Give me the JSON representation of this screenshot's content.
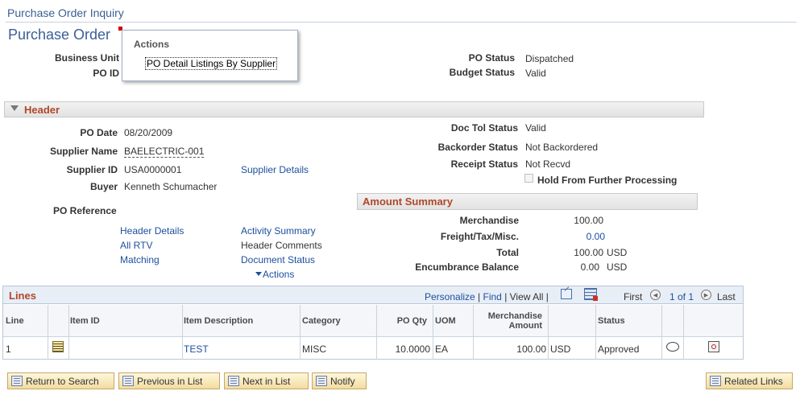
{
  "breadcrumb": "Purchase Order Inquiry",
  "page_title": "Purchase Order",
  "actions_popup": {
    "title": "Actions",
    "item": "PO Detail Listings By Supplier"
  },
  "top": {
    "business_unit_label": "Business Unit",
    "po_id_label": "PO ID",
    "po_status_label": "PO Status",
    "po_status_value": "Dispatched",
    "budget_status_label": "Budget Status",
    "budget_status_value": "Valid"
  },
  "header": {
    "section_label": "Header",
    "po_date_label": "PO Date",
    "po_date": "08/20/2009",
    "supplier_name_label": "Supplier Name",
    "supplier_name": "BAELECTRIC-001",
    "supplier_id_label": "Supplier ID",
    "supplier_id": "USA0000001",
    "supplier_details_link": "Supplier Details",
    "buyer_label": "Buyer",
    "buyer": "Kenneth Schumacher",
    "po_reference_label": "PO Reference",
    "doc_tol_label": "Doc Tol Status",
    "doc_tol": "Valid",
    "backorder_label": "Backorder Status",
    "backorder": "Not Backordered",
    "receipt_label": "Receipt Status",
    "receipt": "Not Recvd",
    "hold_label": "Hold From Further Processing",
    "links_left": [
      "Header Details",
      "All RTV",
      "Matching"
    ],
    "links_right": [
      "Activity Summary",
      "Header Comments",
      "Document Status"
    ],
    "actions_link": "Actions"
  },
  "amount_summary": {
    "label": "Amount Summary",
    "merch_label": "Merchandise",
    "merch": "100.00",
    "freight_label": "Freight/Tax/Misc.",
    "freight": "0.00",
    "total_label": "Total",
    "total": "100.00",
    "total_currency": "USD",
    "encumbrance_label": "Encumbrance Balance",
    "encumbrance": "0.00",
    "encumbrance_currency": "USD"
  },
  "lines": {
    "title": "Lines",
    "nav": {
      "personalize": "Personalize",
      "find": "Find",
      "view_all": "View All",
      "first": "First",
      "range": "1 of 1",
      "last": "Last"
    },
    "columns": [
      "Line",
      "Item ID",
      "Item Description",
      "Category",
      "PO Qty",
      "UOM",
      "Merchandise Amount",
      "Status"
    ],
    "rows": [
      {
        "line": "1",
        "item_id": "",
        "description": "TEST",
        "category": "MISC",
        "po_qty": "10.0000",
        "uom": "EA",
        "amount": "100.00",
        "currency": "USD",
        "status": "Approved"
      }
    ]
  },
  "buttons": {
    "return": "Return to Search",
    "previous": "Previous in List",
    "next": "Next in List",
    "notify": "Notify",
    "related": "Related Links"
  },
  "colors": {
    "accent": "#b0472a",
    "link": "#1c4f9e",
    "title": "#3b5f95"
  }
}
